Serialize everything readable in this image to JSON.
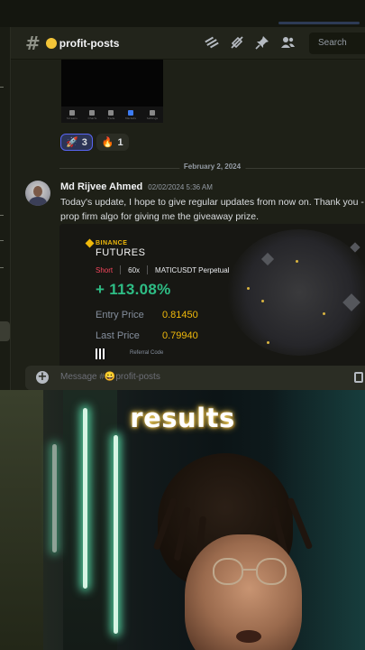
{
  "channel": {
    "name": "profit-posts",
    "search_placeholder": "Search",
    "header_icons": [
      "threads-icon",
      "mute-icon",
      "pin-icon",
      "members-icon"
    ]
  },
  "previous_message": {
    "app_nav": [
      "Screens",
      "Charts",
      "Trade",
      "Markets",
      "Settings"
    ],
    "reactions": [
      {
        "icon": "rocket-icon",
        "glyph": "🚀",
        "count": "3",
        "selected": true
      },
      {
        "icon": "fire-icon",
        "glyph": "🔥",
        "count": "1",
        "selected": false
      }
    ]
  },
  "date_divider": "February 2, 2024",
  "message": {
    "author": "Md Rijvee Ahmed",
    "timestamp": "02/02/2024 5:36 AM",
    "text_line1": "Today's update, I hope to give regular updates from now on. Thank you -",
    "text_line2": "prop firm algo for giving me the giveaway prize."
  },
  "trade_card": {
    "brand": "BINANCE",
    "product": "FUTURES",
    "side": "Short",
    "leverage": "60x",
    "pair": "MATICUSDT Perpetual",
    "pnl": "+ 113.08%",
    "entry_label": "Entry Price",
    "entry_value": "0.81450",
    "last_label": "Last Price",
    "last_value": "0.79940",
    "referral_label": "Referral Code",
    "colors": {
      "short": "#f6465d",
      "pnl": "#2ebd85",
      "price": "#f0b90b"
    }
  },
  "composer": {
    "placeholder": "Message #😀profit-posts"
  },
  "video": {
    "caption": "results"
  }
}
